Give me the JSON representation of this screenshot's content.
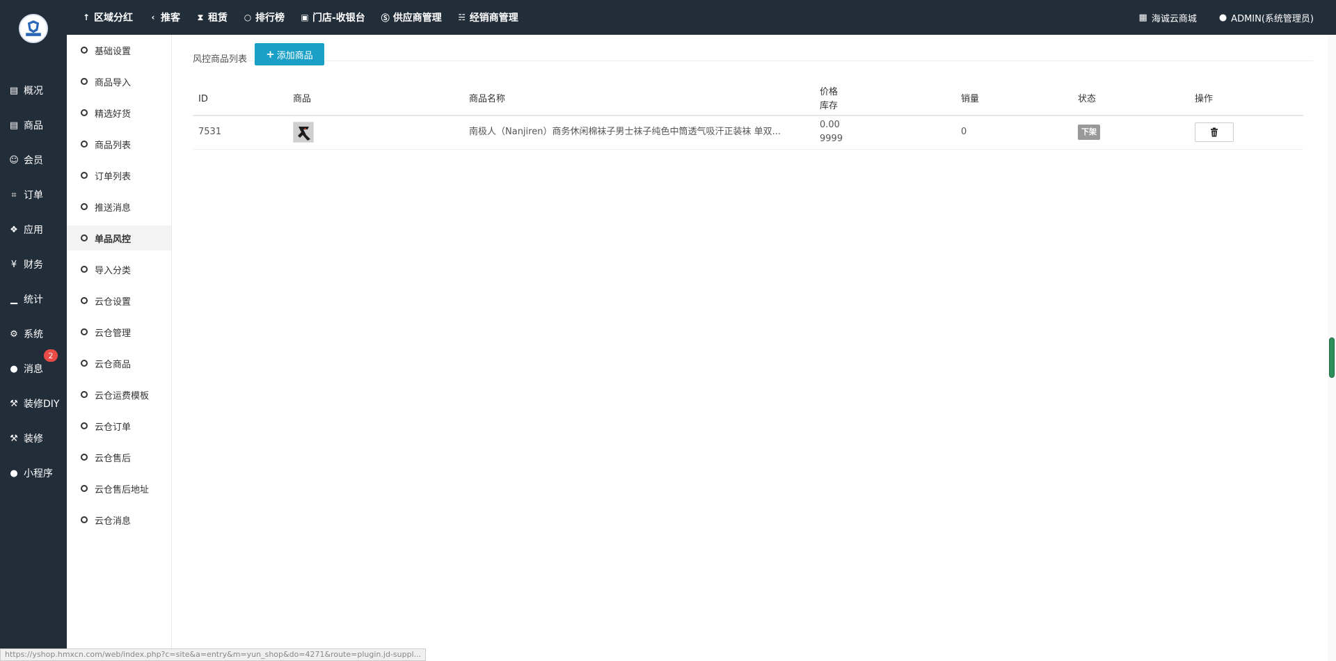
{
  "topnav": [
    {
      "icon": "trophy-icon",
      "glyph": "↑",
      "label": "区域分红"
    },
    {
      "icon": "share-icon",
      "glyph": "‹",
      "label": "推客"
    },
    {
      "icon": "hourglass-icon",
      "glyph": "⧗",
      "label": "租赁"
    },
    {
      "icon": "circle-icon",
      "glyph": "○",
      "label": "排行榜"
    },
    {
      "icon": "cashier-icon",
      "glyph": "▣",
      "label": "门店-收银台"
    },
    {
      "icon": "skype-icon",
      "glyph": "Ⓢ",
      "label": "供应商管理"
    },
    {
      "icon": "handshake-icon",
      "glyph": "☵",
      "label": "经销商管理"
    }
  ],
  "topright": {
    "shop_label": "海诚云商城",
    "user_label": "ADMIN(系统管理员)"
  },
  "sidebar": [
    {
      "name": "overview",
      "icon": "archive-icon",
      "glyph": "▤",
      "label": "概况"
    },
    {
      "name": "goods",
      "icon": "archive-icon",
      "glyph": "▤",
      "label": "商品"
    },
    {
      "name": "members",
      "icon": "users-icon",
      "glyph": "☺",
      "label": "会员"
    },
    {
      "name": "orders",
      "icon": "cart-icon",
      "glyph": "⌗",
      "label": "订单"
    },
    {
      "name": "apps",
      "icon": "cubes-icon",
      "glyph": "❖",
      "label": "应用"
    },
    {
      "name": "finance",
      "icon": "yen-icon",
      "glyph": "¥",
      "label": "财务"
    },
    {
      "name": "stats",
      "icon": "bar-chart-icon",
      "glyph": "▁",
      "label": "统计"
    },
    {
      "name": "system",
      "icon": "gears-icon",
      "glyph": "⚙",
      "label": "系统"
    },
    {
      "name": "messages",
      "icon": "comment-icon",
      "glyph": "●",
      "label": "消息",
      "badge": "2"
    },
    {
      "name": "diy",
      "icon": "gavel-icon",
      "glyph": "⚒",
      "label": "装修DIY"
    },
    {
      "name": "decor",
      "icon": "gavel-icon",
      "glyph": "⚒",
      "label": "装修"
    },
    {
      "name": "miniprogram",
      "icon": "wechat-icon",
      "glyph": "●",
      "label": "小程序"
    }
  ],
  "submenu": [
    {
      "label": "基础设置",
      "active": false
    },
    {
      "label": "商品导入",
      "active": false
    },
    {
      "label": "精选好货",
      "active": false
    },
    {
      "label": "商品列表",
      "active": false
    },
    {
      "label": "订单列表",
      "active": false
    },
    {
      "label": "推送消息",
      "active": false
    },
    {
      "label": "单品风控",
      "active": true
    },
    {
      "label": "导入分类",
      "active": false
    },
    {
      "label": "云仓设置",
      "active": false
    },
    {
      "label": "云仓管理",
      "active": false
    },
    {
      "label": "云仓商品",
      "active": false
    },
    {
      "label": "云仓运费模板",
      "active": false
    },
    {
      "label": "云仓订单",
      "active": false
    },
    {
      "label": "云仓售后",
      "active": false
    },
    {
      "label": "云仓售后地址",
      "active": false
    },
    {
      "label": "云仓消息",
      "active": false
    }
  ],
  "page": {
    "breadcrumb": "风控商品列表",
    "add_button": "添加商品"
  },
  "table": {
    "headers": {
      "id": "ID",
      "goods": "商品",
      "name": "商品名称",
      "price": "价格",
      "stock": "库存",
      "sales": "销量",
      "status": "状态",
      "actions": "操作"
    },
    "rows": [
      {
        "id": "7531",
        "name": "南极人（Nanjiren）商务休闲棉袜子男士袜子纯色中筒透气吸汗正装袜 单双...",
        "price": "0.00",
        "stock": "9999",
        "sales": "0",
        "status": "下架"
      }
    ]
  },
  "statusbar": "https://yshop.hmxcn.com/web/index.php?c=site&a=entry&m=yun_shop&do=4271&route=plugin.jd-suppl..."
}
